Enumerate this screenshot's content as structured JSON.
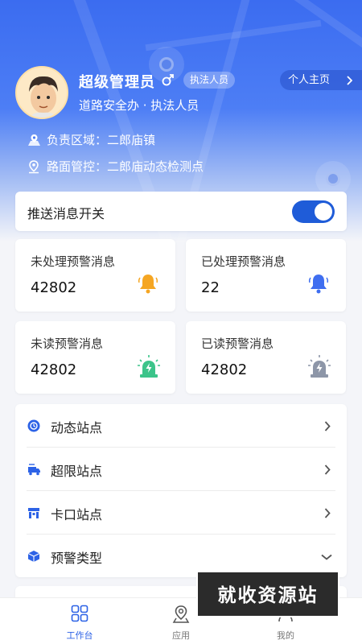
{
  "profile": {
    "name": "超级管理员",
    "gender_symbol": "♂",
    "role_badge": "执法人员",
    "home_link": "个人主页",
    "department": "道路安全办 · 执法人员",
    "region_label": "负责区域：",
    "region_value": "二郎庙镇",
    "control_label": "路面管控：",
    "control_value": "二郎庙动态检测点"
  },
  "push_toggle": {
    "label": "推送消息开关",
    "on": true
  },
  "stats": [
    {
      "title": "未处理预警消息",
      "value": "42802",
      "icon": "bell-orange-icon"
    },
    {
      "title": "已处理预警消息",
      "value": "22",
      "icon": "bell-blue-icon"
    },
    {
      "title": "未读预警消息",
      "value": "42802",
      "icon": "alarm-light-green-icon"
    },
    {
      "title": "已读预警消息",
      "value": "42802",
      "icon": "alarm-light-gray-icon"
    }
  ],
  "menu": [
    {
      "label": "动态站点",
      "icon": "dynamic-station-icon",
      "action": "chevron-right"
    },
    {
      "label": "超限站点",
      "icon": "overlimit-station-icon",
      "action": "chevron-right"
    },
    {
      "label": "卡口站点",
      "icon": "checkpoint-station-icon",
      "action": "chevron-right"
    },
    {
      "label": "预警类型",
      "icon": "warning-type-icon",
      "action": "chevron-down"
    }
  ],
  "tabs": [
    {
      "label": "工作台",
      "icon": "grid-icon",
      "active": true
    },
    {
      "label": "应用",
      "icon": "map-pin-icon",
      "active": false
    },
    {
      "label": "我的",
      "icon": "user-icon",
      "active": false
    }
  ],
  "watermark": "就收资源站",
  "colors": {
    "primary": "#2c62e6",
    "accent_orange": "#f5a623",
    "accent_green": "#3cc48a"
  }
}
